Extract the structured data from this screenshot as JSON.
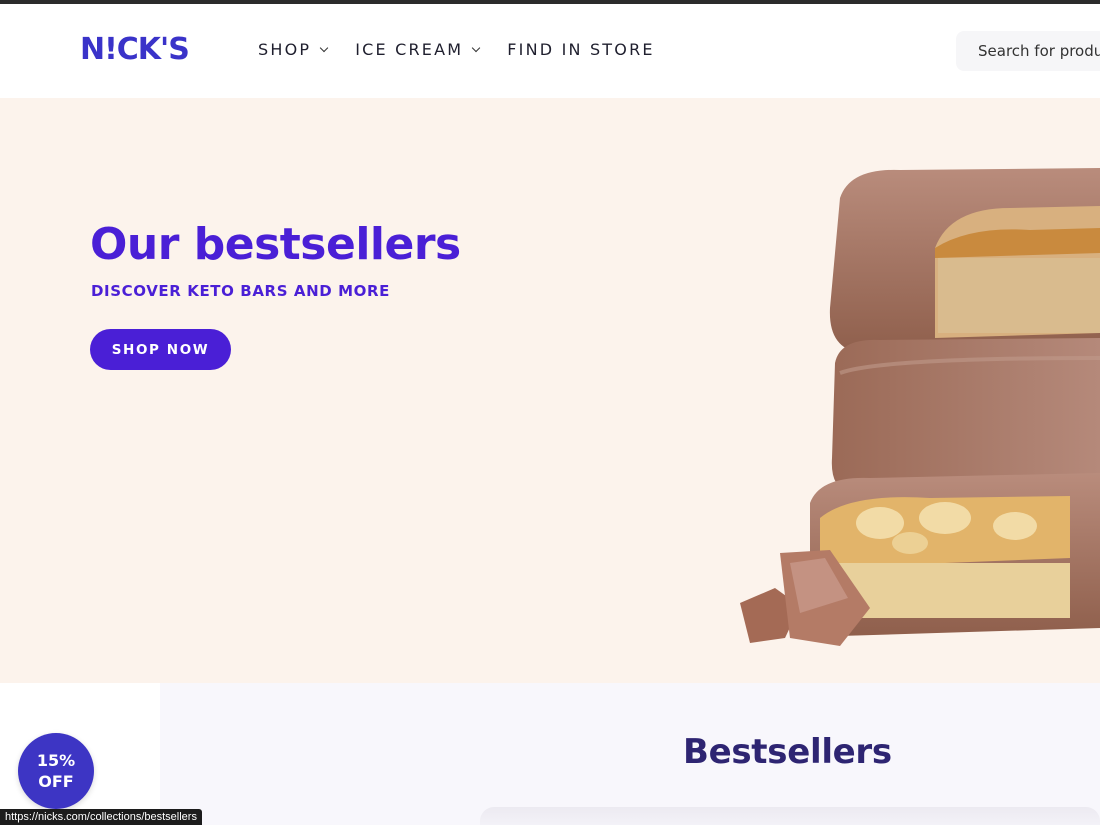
{
  "header": {
    "logo_text": "N!CK'S",
    "nav": [
      {
        "label": "SHOP",
        "has_dropdown": true
      },
      {
        "label": "ICE CREAM",
        "has_dropdown": true
      },
      {
        "label": "FIND IN STORE",
        "has_dropdown": false
      }
    ],
    "search_placeholder": "Search for products"
  },
  "hero": {
    "title": "Our bestsellers",
    "subtitle": "DISCOVER KETO BARS AND MORE",
    "button_label": "SHOP NOW",
    "image_icon": "chocolate-bars-image"
  },
  "section": {
    "heading": "Bestsellers"
  },
  "promo": {
    "line1": "15%",
    "line2": "OFF"
  },
  "status_bar": {
    "url": "https://nicks.com/collections/bestsellers"
  },
  "colors": {
    "brand": "#4a1fd6",
    "logo": "#3a33c9",
    "hero_bg": "#fcf3ec",
    "heading_dark": "#2e2572"
  }
}
